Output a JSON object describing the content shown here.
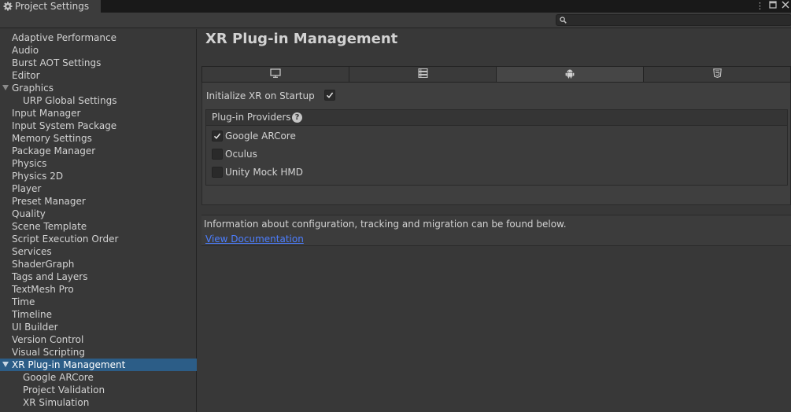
{
  "window": {
    "tab_title": "Project Settings",
    "tab_icon": "gear-icon"
  },
  "search": {
    "placeholder": ""
  },
  "sidebar": {
    "items": [
      {
        "label": "Adaptive Performance",
        "level": 0
      },
      {
        "label": "Audio",
        "level": 0
      },
      {
        "label": "Burst AOT Settings",
        "level": 0
      },
      {
        "label": "Editor",
        "level": 0
      },
      {
        "label": "Graphics",
        "level": 0,
        "expanded": true
      },
      {
        "label": "URP Global Settings",
        "level": 1
      },
      {
        "label": "Input Manager",
        "level": 0
      },
      {
        "label": "Input System Package",
        "level": 0
      },
      {
        "label": "Memory Settings",
        "level": 0
      },
      {
        "label": "Package Manager",
        "level": 0
      },
      {
        "label": "Physics",
        "level": 0
      },
      {
        "label": "Physics 2D",
        "level": 0
      },
      {
        "label": "Player",
        "level": 0
      },
      {
        "label": "Preset Manager",
        "level": 0
      },
      {
        "label": "Quality",
        "level": 0
      },
      {
        "label": "Scene Template",
        "level": 0
      },
      {
        "label": "Script Execution Order",
        "level": 0
      },
      {
        "label": "Services",
        "level": 0
      },
      {
        "label": "ShaderGraph",
        "level": 0
      },
      {
        "label": "Tags and Layers",
        "level": 0
      },
      {
        "label": "TextMesh Pro",
        "level": 0
      },
      {
        "label": "Time",
        "level": 0
      },
      {
        "label": "Timeline",
        "level": 0
      },
      {
        "label": "UI Builder",
        "level": 0
      },
      {
        "label": "Version Control",
        "level": 0
      },
      {
        "label": "Visual Scripting",
        "level": 0
      },
      {
        "label": "XR Plug-in Management",
        "level": 0,
        "expanded": true,
        "selected": true
      },
      {
        "label": "Google ARCore",
        "level": 1
      },
      {
        "label": "Project Validation",
        "level": 1
      },
      {
        "label": "XR Simulation",
        "level": 1
      }
    ]
  },
  "main": {
    "title": "XR Plug-in Management",
    "platform_tabs": [
      {
        "icon": "desktop-icon",
        "active": false
      },
      {
        "icon": "server-icon",
        "active": false
      },
      {
        "icon": "android-icon",
        "active": true
      },
      {
        "icon": "html5-icon",
        "active": false
      }
    ],
    "init_on_startup": {
      "label": "Initialize XR on Startup",
      "checked": true
    },
    "providers": {
      "header": "Plug-in Providers",
      "items": [
        {
          "label": "Google ARCore",
          "checked": true
        },
        {
          "label": "Oculus",
          "checked": false
        },
        {
          "label": "Unity Mock HMD",
          "checked": false
        }
      ]
    },
    "info": {
      "text": "Information about configuration, tracking and migration can be found below.",
      "link": "View Documentation"
    }
  },
  "colors": {
    "selection": "#2c5d87",
    "link": "#4c7eff",
    "background": "#383838"
  }
}
